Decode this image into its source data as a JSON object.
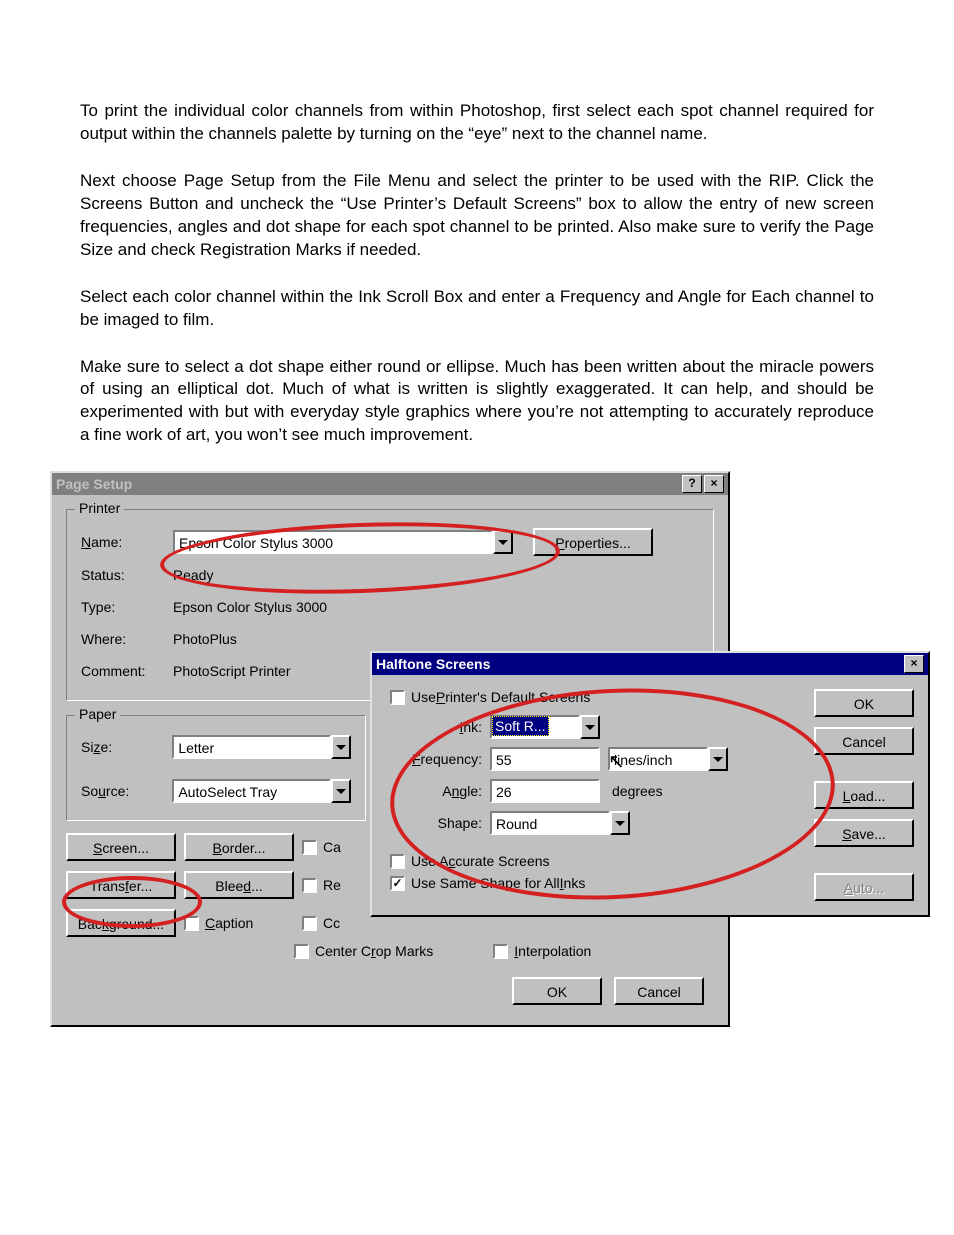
{
  "paragraphs": {
    "p1": "To print the individual color channels from within Photoshop, first select each spot channel required for output within the channels palette by turning on the “eye” next to the channel name.",
    "p2": "Next choose Page Setup from the File Menu and select the printer to be used with the RIP.  Click the Screens Button and uncheck the “Use Printer’s Default Screens” box to allow the entry of new screen frequencies, angles and dot shape for each spot channel to be printed.  Also make sure to verify the Page Size and check Registration Marks if needed.",
    "p3": "Select each color channel within the Ink Scroll Box and enter a Frequency and Angle for Each channel to be imaged to film.",
    "p4": "Make sure to select a dot shape either round or ellipse.  Much has been written about the miracle powers of using an elliptical dot.  Much of what is written is slightly exaggerated.  It can help, and should be experimented with but with everyday style graphics where you’re not attempting to accurately reproduce a fine work of art, you won’t see much improvement."
  },
  "page_setup": {
    "title": "Page Setup",
    "help_btn": "?",
    "close_btn": "×",
    "printer": {
      "group": "Printer",
      "name_label": "Name:",
      "name_value": "Epson Color Stylus 3000",
      "properties_btn": "Properties...",
      "status_label": "Status:",
      "status_value": "Ready",
      "type_label": "Type:",
      "type_value": "Epson Color Stylus 3000",
      "where_label": "Where:",
      "where_value": "PhotoPlus",
      "comment_label": "Comment:",
      "comment_value": "PhotoScript Printer"
    },
    "paper": {
      "group": "Paper",
      "size_label": "Size:",
      "size_value": "Letter",
      "source_label": "Source:",
      "source_value": "AutoSelect Tray"
    },
    "buttons": {
      "screen": "Screen...",
      "border": "Border...",
      "transfer": "Transfer...",
      "bleed": "Bleed...",
      "background": "Background...",
      "caption": "Caption",
      "ca_frag": "Ca",
      "re_frag": "Re",
      "cc_frag": "Cc",
      "center_crop": "Center Crop Marks",
      "interpolation": "Interpolation"
    },
    "ok": "OK",
    "cancel": "Cancel"
  },
  "halftone": {
    "title": "Halftone Screens",
    "close_btn": "×",
    "use_default": "Use Printer's Default Screens",
    "ink_label": "Ink:",
    "ink_value": "Soft R...",
    "freq_label": "Frequency:",
    "freq_value": "55",
    "freq_unit": "lines/inch",
    "angle_label": "Angle:",
    "angle_value": "26",
    "angle_unit": "degrees",
    "shape_label": "Shape:",
    "shape_value": "Round",
    "use_accurate": "Use Accurate Screens",
    "same_shape": "Use Same Shape for All Inks",
    "ok": "OK",
    "cancel": "Cancel",
    "load": "Load...",
    "save": "Save...",
    "auto": "Auto..."
  }
}
